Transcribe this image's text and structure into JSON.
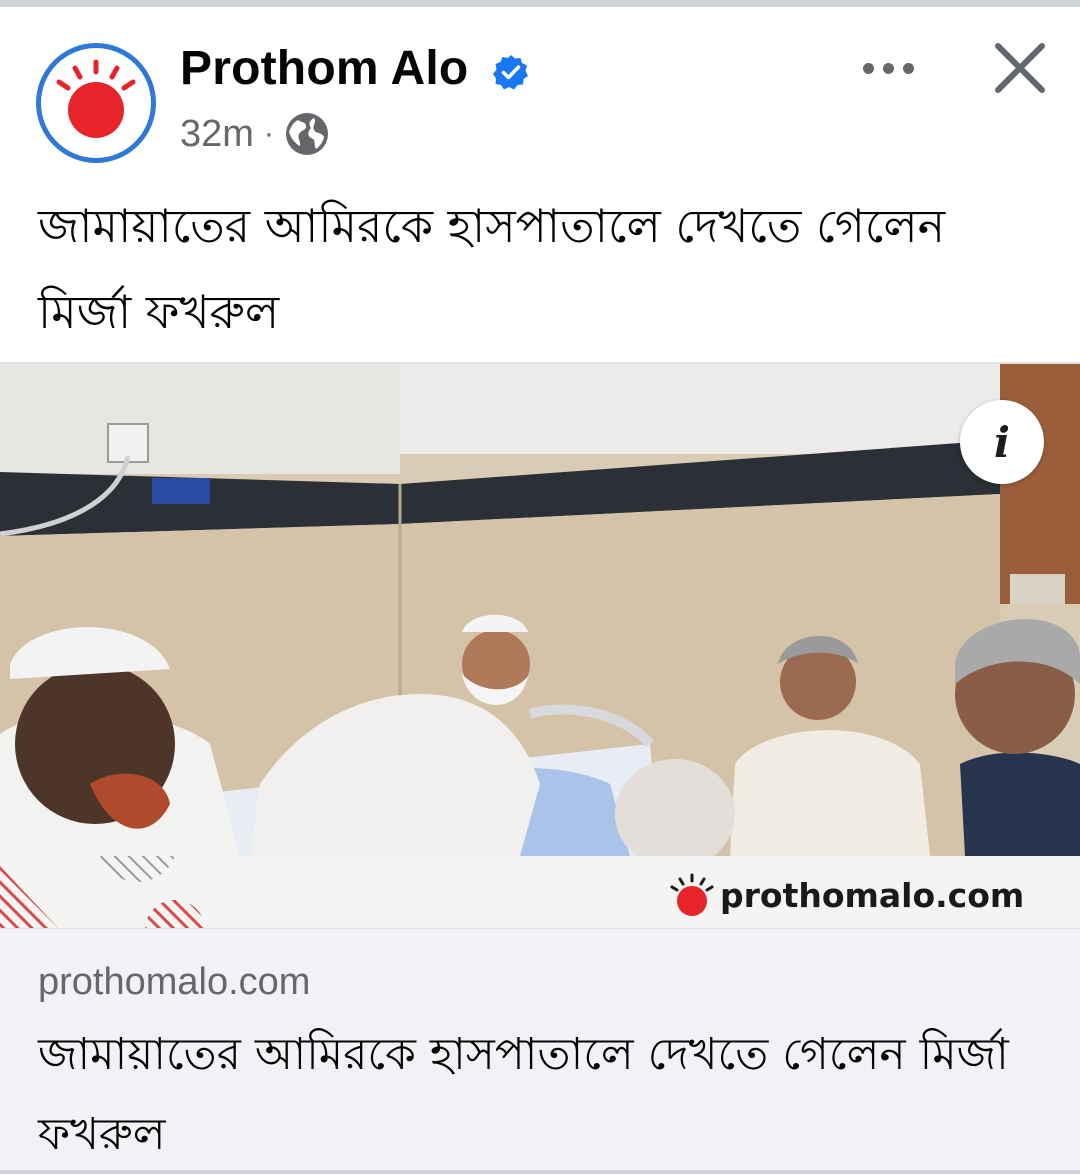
{
  "post": {
    "page_name": "Prothom Alo",
    "verified": true,
    "time_ago": "32m",
    "separator": "·",
    "audience_icon": "globe-icon",
    "text": "জামায়াতের আমিরকে হাসপাতালে দেখতে গেলেন মির্জা ফখরুল"
  },
  "header_actions": {
    "more_icon": "more-options-icon",
    "close_icon": "close-icon"
  },
  "image": {
    "info_label": "i",
    "watermark_text": "prothomalo.com"
  },
  "link_preview": {
    "domain": "prothomalo.com",
    "title": "জামায়াতের আমিরকে হাসপাতালে দেখতে গেলেন মির্জা ফখরুল"
  },
  "colors": {
    "brand_red": "#e8242b",
    "avatar_ring": "#2f78d8",
    "verified_blue": "#1877f2",
    "meta_gray": "#65676b"
  }
}
